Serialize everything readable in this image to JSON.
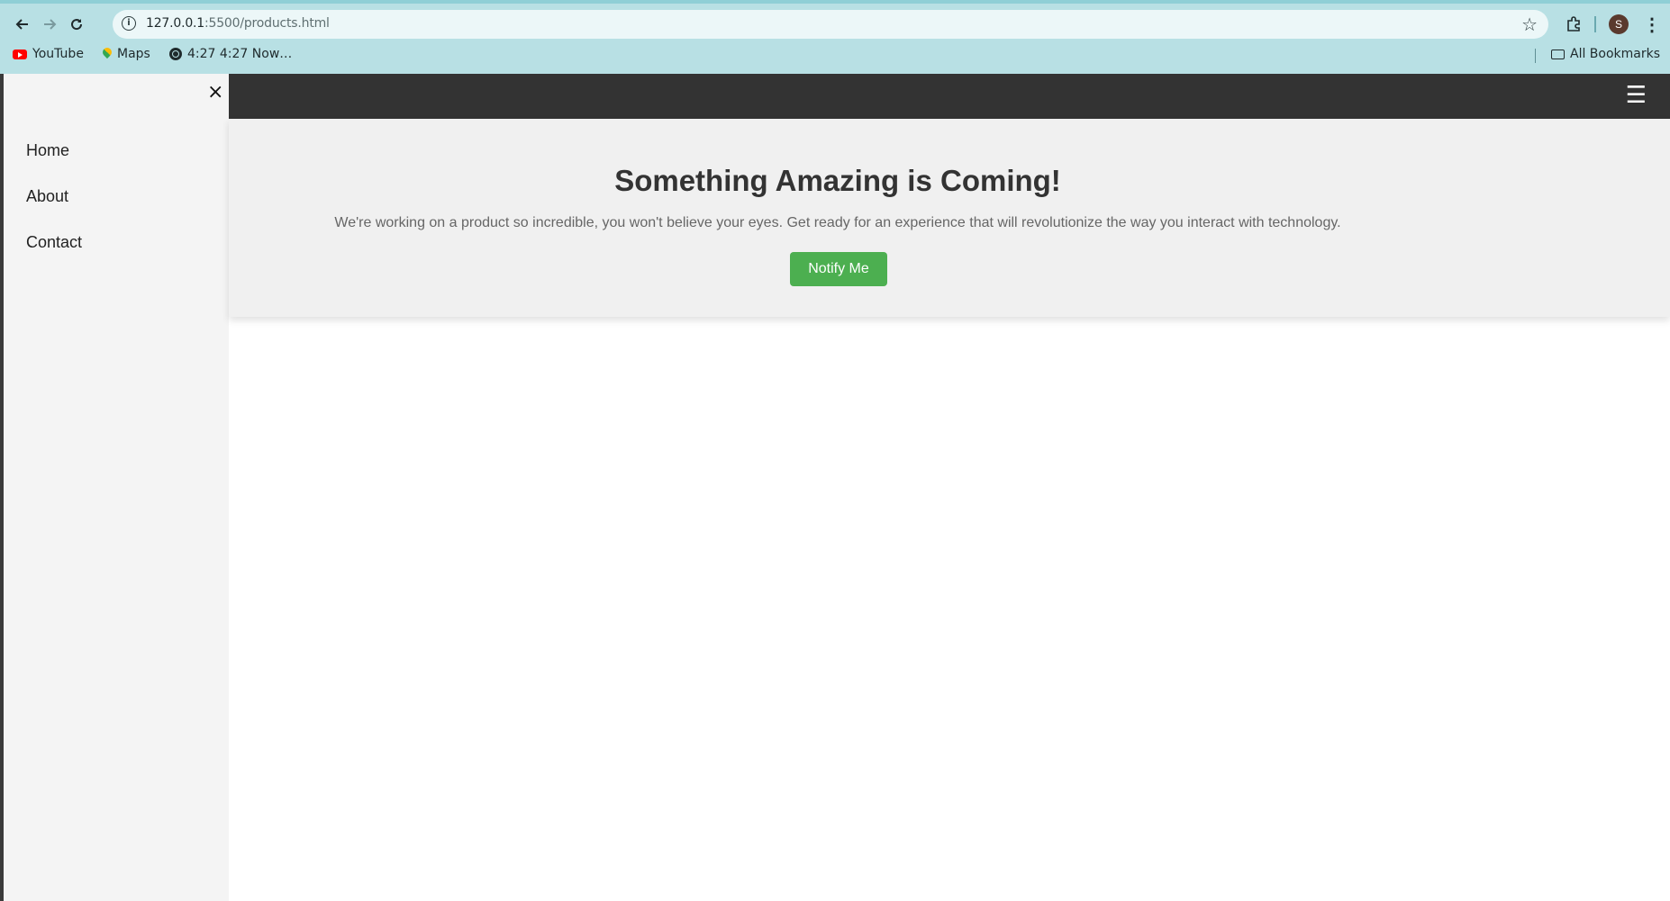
{
  "browser": {
    "url_host": "127.0.0.1",
    "url_path": ":5500/products.html",
    "profile_initial": "S",
    "bookmarks": [
      {
        "label": "YouTube",
        "icon": "youtube-icon"
      },
      {
        "label": "Maps",
        "icon": "maps-icon"
      },
      {
        "label": "4:27 4:27 Now…",
        "icon": "globe-icon"
      }
    ],
    "all_bookmarks_label": "All Bookmarks"
  },
  "sidebar": {
    "close_glyph": "×",
    "items": [
      {
        "label": "Home"
      },
      {
        "label": "About"
      },
      {
        "label": "Contact"
      }
    ]
  },
  "topbar": {
    "menu_glyph": "☰"
  },
  "hero": {
    "title": "Something Amazing is Coming!",
    "description": "We're working on a product so incredible, you won't believe your eyes. Get ready for an experience that will revolutionize the way you interact with technology.",
    "button_label": "Notify Me",
    "button_color": "#4caf50"
  },
  "colors": {
    "chrome": "#b8e0e4",
    "topbar": "#333333",
    "hero_bg": "#f0f0f0",
    "sidebar_bg": "#f4f4f4"
  }
}
